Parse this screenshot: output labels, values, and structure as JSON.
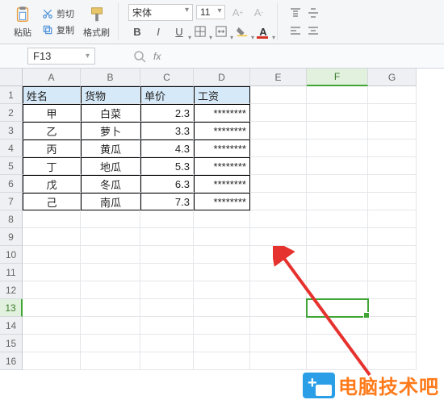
{
  "ribbon": {
    "paste_label": "粘贴",
    "cut_label": "剪切",
    "copy_label": "复制",
    "format_painter_label": "格式刷",
    "font_name": "宋体",
    "font_size": "11"
  },
  "namebox": {
    "value": "F13"
  },
  "columns": [
    "A",
    "B",
    "C",
    "D",
    "E",
    "F",
    "G"
  ],
  "col_widths": [
    "cA",
    "cB",
    "cC",
    "cD",
    "cE",
    "cF",
    "cG"
  ],
  "selected_col": "F",
  "selected_row": 13,
  "row_count": 16,
  "table": {
    "first_row": 1,
    "last_row": 7,
    "first_col": 0,
    "last_col": 3,
    "header_row": 1,
    "headers": [
      "姓名",
      "货物",
      "单价",
      "工资"
    ],
    "rows": [
      {
        "name": "甲",
        "goods": "白菜",
        "price": "2.3",
        "salary": "********"
      },
      {
        "name": "乙",
        "goods": "萝卜",
        "price": "3.3",
        "salary": "********"
      },
      {
        "name": "丙",
        "goods": "黄瓜",
        "price": "4.3",
        "salary": "********"
      },
      {
        "name": "丁",
        "goods": "地瓜",
        "price": "5.3",
        "salary": "********"
      },
      {
        "name": "戊",
        "goods": "冬瓜",
        "price": "6.3",
        "salary": "********"
      },
      {
        "name": "己",
        "goods": "南瓜",
        "price": "7.3",
        "salary": "********"
      }
    ]
  },
  "watermark": {
    "text": "电脑技术吧"
  }
}
